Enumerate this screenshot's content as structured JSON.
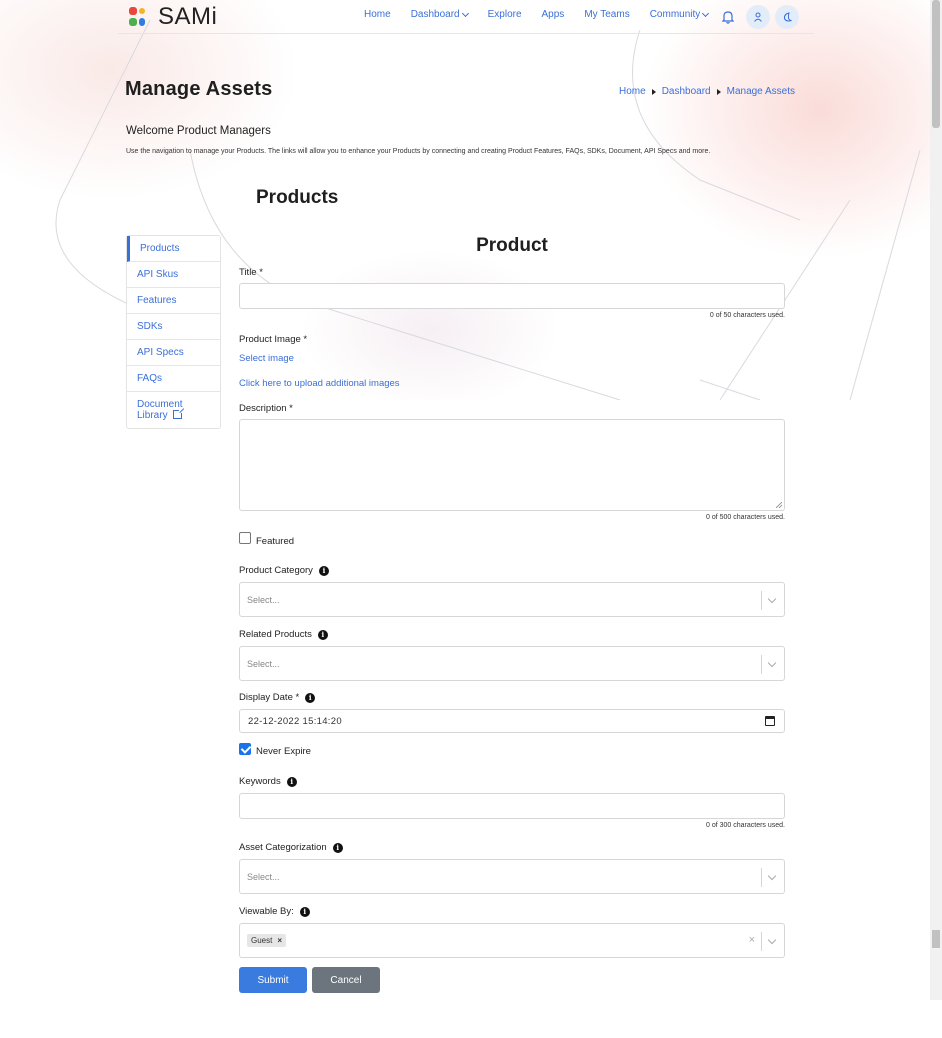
{
  "app": {
    "name": "SAMi",
    "brand_colors": [
      "#e8463f",
      "#f5b324",
      "#4caf50",
      "#2f7de1"
    ],
    "accent": "#3a6fd8"
  },
  "nav": {
    "items": [
      {
        "label": "Home"
      },
      {
        "label": "Dashboard",
        "dropdown": true
      },
      {
        "label": "Explore"
      },
      {
        "label": "Apps"
      },
      {
        "label": "My Teams"
      },
      {
        "label": "Community",
        "dropdown": true
      }
    ],
    "icons": [
      "bell-icon",
      "user-icon",
      "moon-icon"
    ]
  },
  "page": {
    "title": "Manage Assets",
    "breadcrumb": [
      "Home",
      "Dashboard",
      "Manage Assets"
    ],
    "welcome_heading": "Welcome Product Managers",
    "welcome_text": "Use the navigation to manage your Products. The links will allow you to enhance your Products by connecting and creating Product Features, FAQs, SDKs, Document, API Specs and more.",
    "section_title": "Products"
  },
  "sidebar": {
    "items": [
      {
        "label": "Products",
        "active": true
      },
      {
        "label": "API Skus"
      },
      {
        "label": "Features"
      },
      {
        "label": "SDKs"
      },
      {
        "label": "API Specs"
      },
      {
        "label": "FAQs"
      },
      {
        "label_line1": "Document",
        "label_line2": "Library",
        "external": true
      }
    ]
  },
  "form": {
    "title": "Product",
    "title_field": {
      "label": "Title *",
      "value": "",
      "counter": "0 of 50 characters used."
    },
    "image_field": {
      "label": "Product Image *",
      "select_link": "Select image",
      "upload_link": "Click here to upload additional images"
    },
    "description_field": {
      "label": "Description *",
      "value": "",
      "counter": "0 of 500 characters used."
    },
    "featured": {
      "label": "Featured",
      "checked": false
    },
    "product_category": {
      "label": "Product Category",
      "placeholder": "Select..."
    },
    "related_products": {
      "label": "Related Products",
      "placeholder": "Select..."
    },
    "display_date": {
      "label": "Display Date *",
      "value": "22-12-2022 15:14:20"
    },
    "never_expire": {
      "label": "Never Expire",
      "checked": true
    },
    "keywords": {
      "label": "Keywords",
      "value": "",
      "counter": "0 of 300 characters used."
    },
    "asset_categorization": {
      "label": "Asset Categorization",
      "placeholder": "Select..."
    },
    "viewable_by": {
      "label": "Viewable By:",
      "chips": [
        "Guest"
      ]
    },
    "submit_label": "Submit",
    "cancel_label": "Cancel"
  }
}
